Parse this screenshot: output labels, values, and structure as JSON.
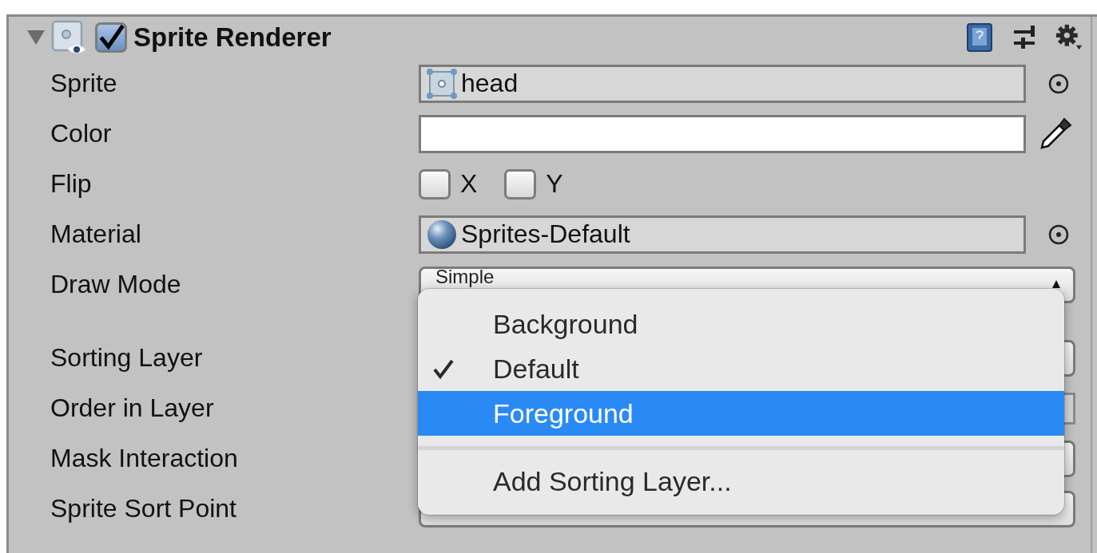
{
  "component": {
    "title": "Sprite Renderer",
    "expanded": true,
    "enabled": true
  },
  "properties": [
    {
      "label": "Sprite",
      "kind": "sprite_object",
      "value": "head"
    },
    {
      "label": "Color",
      "kind": "color",
      "color": "#ffffff"
    },
    {
      "label": "Flip",
      "kind": "flip",
      "toggles": [
        {
          "label": "X",
          "checked": false
        },
        {
          "label": "Y",
          "checked": false
        }
      ]
    },
    {
      "label": "Material",
      "kind": "material_object",
      "value": "Sprites-Default"
    },
    {
      "label": "Draw Mode",
      "kind": "dropdown",
      "value": "Simple"
    },
    {
      "label": "Sorting Layer",
      "kind": "dropdown",
      "gap_before": true
    },
    {
      "label": "Order in Layer",
      "kind": "number"
    },
    {
      "label": "Mask Interaction",
      "kind": "dropdown"
    },
    {
      "label": "Sprite Sort Point",
      "kind": "dropdown"
    }
  ],
  "menu": {
    "items": [
      {
        "label": "Background",
        "kind": "option",
        "checked": false,
        "selected": false
      },
      {
        "label": "Default",
        "kind": "option",
        "checked": true,
        "selected": false
      },
      {
        "label": "Foreground",
        "kind": "option",
        "checked": false,
        "selected": true
      },
      {
        "kind": "separator"
      },
      {
        "label": "Add Sorting Layer...",
        "kind": "action",
        "checked": false,
        "selected": false
      }
    ]
  }
}
